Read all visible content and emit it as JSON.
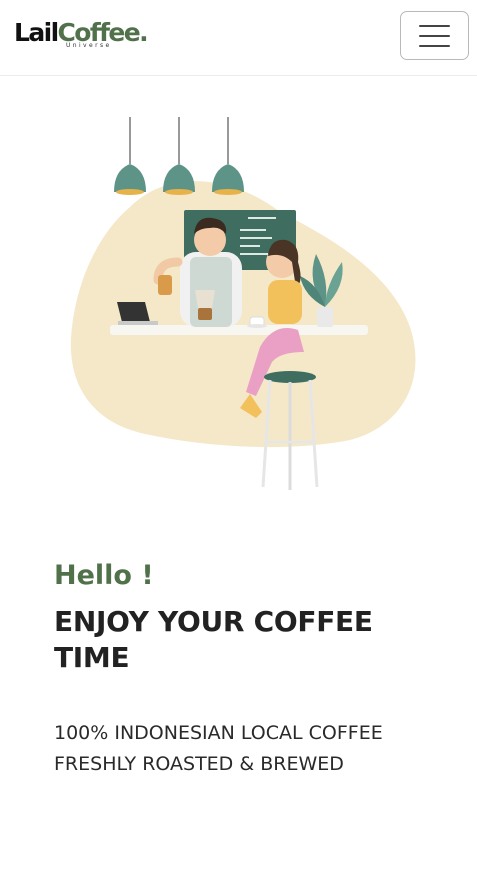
{
  "navbar": {
    "brand_primary": "Lail",
    "brand_secondary": "Coffee.",
    "brand_sub": "Universe",
    "menu_icon": "hamburger-menu-icon"
  },
  "hero": {
    "greeting": "Hello !",
    "headline": "ENJOY YOUR COFFEE TIME",
    "tagline_line1": "100% INDONESIAN LOCAL COFFEE",
    "tagline_line2": "FRESHLY ROASTED & BREWED"
  },
  "colors": {
    "brand_green": "#51714b",
    "headline": "#222222",
    "blob": "#f4e8c8"
  }
}
